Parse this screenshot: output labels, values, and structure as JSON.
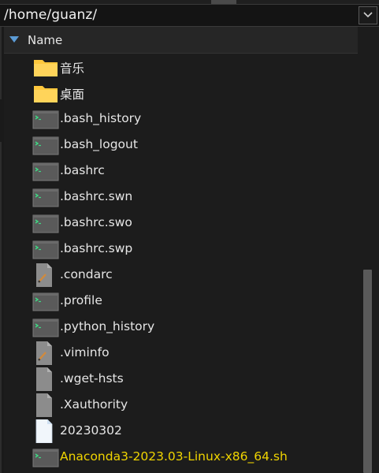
{
  "path": {
    "value": "/home/guanz/"
  },
  "header": {
    "name_label": "Name"
  },
  "files": [
    {
      "name": "音乐",
      "icon": "folder-icon",
      "type": "folder"
    },
    {
      "name": "桌面",
      "icon": "folder-icon",
      "type": "folder"
    },
    {
      "name": ".bash_history",
      "icon": "terminal-file-icon",
      "type": "terminal"
    },
    {
      "name": ".bash_logout",
      "icon": "terminal-file-icon",
      "type": "terminal"
    },
    {
      "name": ".bashrc",
      "icon": "terminal-file-icon",
      "type": "terminal"
    },
    {
      "name": ".bashrc.swn",
      "icon": "terminal-file-icon",
      "type": "terminal"
    },
    {
      "name": ".bashrc.swo",
      "icon": "terminal-file-icon",
      "type": "terminal"
    },
    {
      "name": ".bashrc.swp",
      "icon": "terminal-file-icon",
      "type": "terminal"
    },
    {
      "name": ".condarc",
      "icon": "text-file-icon",
      "type": "pencil"
    },
    {
      "name": ".profile",
      "icon": "terminal-file-icon",
      "type": "terminal"
    },
    {
      "name": ".python_history",
      "icon": "terminal-file-icon",
      "type": "terminal"
    },
    {
      "name": ".viminfo",
      "icon": "text-file-icon",
      "type": "pencil"
    },
    {
      "name": ".wget-hsts",
      "icon": "generic-file-icon",
      "type": "generic"
    },
    {
      "name": ".Xauthority",
      "icon": "generic-file-icon",
      "type": "generic"
    },
    {
      "name": "20230302",
      "icon": "document-icon",
      "type": "doc"
    },
    {
      "name": "Anaconda3-2023.03-Linux-x86_64.sh",
      "icon": "terminal-file-icon",
      "type": "terminal",
      "highlighted": true
    }
  ],
  "colors": {
    "folder": "#ffc83d",
    "highlight_text": "#f0d400",
    "header_arrow": "#5b9bd5"
  }
}
